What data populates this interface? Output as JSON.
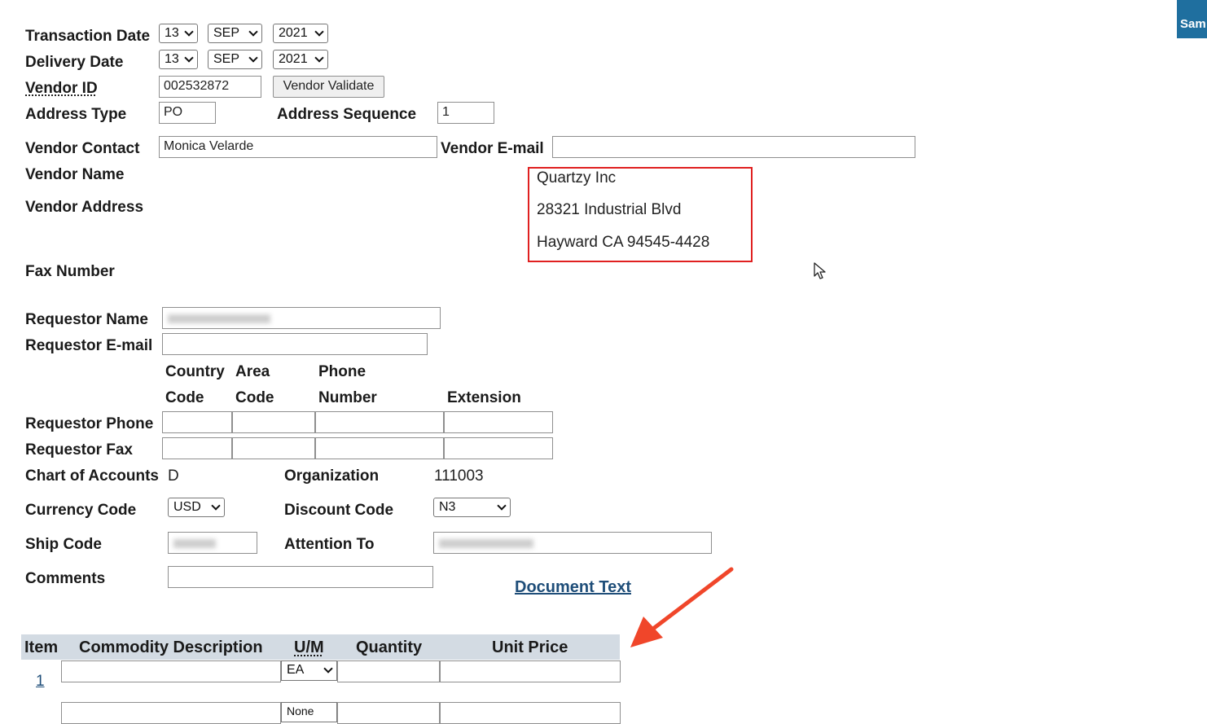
{
  "corner_badge": {
    "label": "Sam"
  },
  "fields": {
    "transaction_date": {
      "label": "Transaction Date",
      "day": "13",
      "month": "SEP",
      "year": "2021"
    },
    "delivery_date": {
      "label": "Delivery Date",
      "day": "13",
      "month": "SEP",
      "year": "2021"
    },
    "vendor_id": {
      "label": "Vendor ID",
      "value": "002532872",
      "validate_button": "Vendor Validate"
    },
    "address_type": {
      "label": "Address Type",
      "value": "PO"
    },
    "address_sequence": {
      "label": "Address Sequence",
      "value": "1"
    },
    "vendor_contact": {
      "label": "Vendor Contact",
      "value": "Monica Velarde"
    },
    "vendor_email": {
      "label": "Vendor E-mail",
      "value": ""
    },
    "vendor_name": {
      "label": "Vendor Name",
      "value": "Quartzy Inc"
    },
    "vendor_address": {
      "label": "Vendor Address",
      "line1": "28321 Industrial Blvd",
      "line2": "Hayward CA 94545-4428"
    },
    "fax_number": {
      "label": "Fax Number"
    },
    "requestor_name": {
      "label": "Requestor Name"
    },
    "requestor_email": {
      "label": "Requestor E-mail"
    },
    "phone_headers": {
      "country_line1": "Country",
      "country_line2": "Code",
      "area_line1": "Area",
      "area_line2": "Code",
      "phone_line1": "Phone",
      "phone_line2": "Number",
      "extension": "Extension"
    },
    "requestor_phone": {
      "label": "Requestor Phone"
    },
    "requestor_fax": {
      "label": "Requestor Fax"
    },
    "chart_of_accounts": {
      "label": "Chart of Accounts",
      "value": "D"
    },
    "organization": {
      "label": "Organization",
      "value": "111003"
    },
    "currency_code": {
      "label": "Currency Code",
      "value": "USD"
    },
    "discount_code": {
      "label": "Discount Code",
      "value": "N3"
    },
    "ship_code": {
      "label": "Ship Code"
    },
    "attention_to": {
      "label": "Attention To"
    },
    "comments": {
      "label": "Comments",
      "value": ""
    },
    "document_text": {
      "label": "Document Text"
    }
  },
  "items_table": {
    "headers": {
      "item": "Item",
      "description": "Commodity Description",
      "um": "U/M",
      "quantity": "Quantity",
      "unit_price": "Unit Price"
    },
    "rows": [
      {
        "item": "1",
        "um": "EA"
      },
      {
        "item": "",
        "um": "None"
      }
    ]
  },
  "colors": {
    "highlight_box": "#e02020",
    "arrow": "#f0462a",
    "link": "#1f4e79",
    "table_header": "#d3dbe3",
    "badge": "#1f6f9f"
  }
}
